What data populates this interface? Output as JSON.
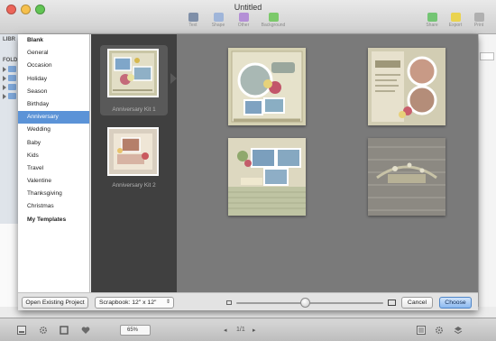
{
  "window": {
    "title": "Untitled"
  },
  "toolbar": {
    "items": [
      {
        "label": "Text",
        "color": "#7f8fa8"
      },
      {
        "label": "Shape",
        "color": "#9fb5d9"
      },
      {
        "label": "Other",
        "color": "#b48fd6"
      },
      {
        "label": "Background",
        "color": "#7bc96a"
      },
      {
        "label": "Share",
        "color": "#74c574"
      },
      {
        "label": "Export",
        "color": "#ead34f"
      },
      {
        "label": "Print",
        "color": "#b0b0b0"
      }
    ]
  },
  "background_window": {
    "library_label": "LIBR",
    "folders_label": "FOLD"
  },
  "categories": [
    {
      "label": "Blank",
      "bold": true,
      "selected": false
    },
    {
      "label": "General",
      "bold": false,
      "selected": false
    },
    {
      "label": "Occasion",
      "bold": false,
      "selected": false
    },
    {
      "label": "Holiday",
      "bold": false,
      "selected": false
    },
    {
      "label": "Season",
      "bold": false,
      "selected": false
    },
    {
      "label": "Birthday",
      "bold": false,
      "selected": false
    },
    {
      "label": "Anniversary",
      "bold": false,
      "selected": true
    },
    {
      "label": "Wedding",
      "bold": false,
      "selected": false
    },
    {
      "label": "Baby",
      "bold": false,
      "selected": false
    },
    {
      "label": "Kids",
      "bold": false,
      "selected": false
    },
    {
      "label": "Travel",
      "bold": false,
      "selected": false
    },
    {
      "label": "Valentine",
      "bold": false,
      "selected": false
    },
    {
      "label": "Thanksgiving",
      "bold": false,
      "selected": false
    },
    {
      "label": "Christmas",
      "bold": false,
      "selected": false
    },
    {
      "label": "My Templates",
      "bold": true,
      "selected": false
    }
  ],
  "kits": [
    {
      "label": "Anniversary Kit 1",
      "selected": true
    },
    {
      "label": "Anniversary Kit 2",
      "selected": false
    }
  ],
  "previews": {
    "count": 4
  },
  "footer": {
    "open_button": "Open Existing Project",
    "scrapbook_select": "Scrapbook: 12\" x 12\"",
    "cancel_button": "Cancel",
    "choose_button": "Choose",
    "slider_value": 0.47
  },
  "bottombar": {
    "zoom": "65%",
    "page_indicator": "1/1"
  }
}
